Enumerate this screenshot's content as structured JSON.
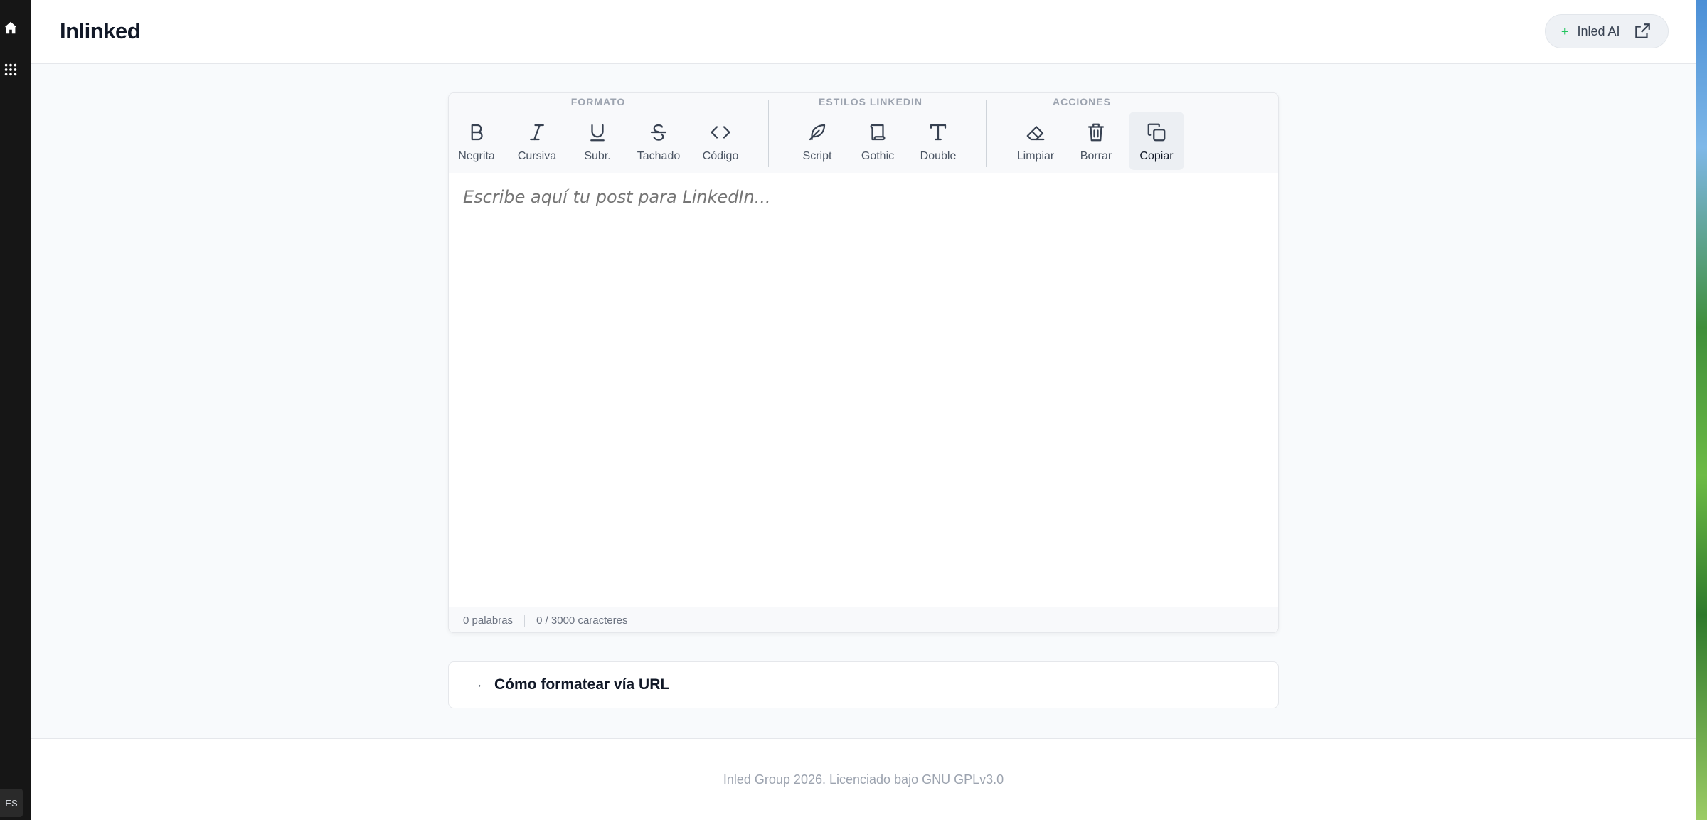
{
  "app": {
    "title": "Inlinked",
    "ai_button_label": "Inled AI",
    "ai_button_plus": "+"
  },
  "rail": {
    "lang": "ES"
  },
  "toolbar": {
    "groups": [
      {
        "title": "FORMATO",
        "tools": [
          {
            "label": "Negrita",
            "icon": "bold-icon"
          },
          {
            "label": "Cursiva",
            "icon": "italic-icon"
          },
          {
            "label": "Subr.",
            "icon": "underline-icon"
          },
          {
            "label": "Tachado",
            "icon": "strikethrough-icon"
          },
          {
            "label": "Código",
            "icon": "code-icon"
          }
        ]
      },
      {
        "title": "ESTILOS LINKEDIN",
        "tools": [
          {
            "label": "Script",
            "icon": "feather-icon"
          },
          {
            "label": "Gothic",
            "icon": "scroll-icon"
          },
          {
            "label": "Double",
            "icon": "type-icon"
          }
        ]
      },
      {
        "title": "ACCIONES",
        "tools": [
          {
            "label": "Limpiar",
            "icon": "eraser-icon"
          },
          {
            "label": "Borrar",
            "icon": "trash-icon"
          },
          {
            "label": "Copiar",
            "icon": "copy-icon"
          }
        ]
      }
    ]
  },
  "editor": {
    "placeholder": "Escribe aquí tu post para LinkedIn...",
    "value": ""
  },
  "status": {
    "words": "0 palabras",
    "chars": "0 / 3000 caracteres"
  },
  "accordion": {
    "arrow": "→",
    "title": "Cómo formatear vía URL"
  },
  "footer": {
    "text": "Inled Group 2026. Licenciado bajo GNU GPLv3.0"
  },
  "colors": {
    "accent_plus": "#22c55e",
    "rail_bg": "#161616"
  }
}
